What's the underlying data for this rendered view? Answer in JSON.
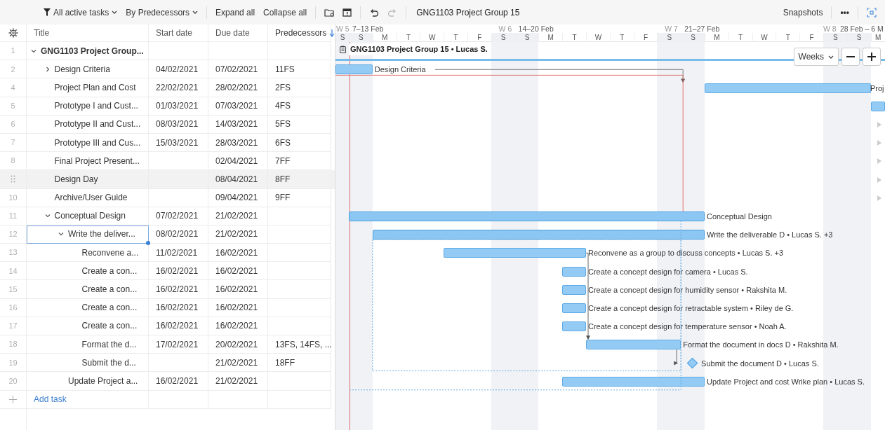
{
  "toolbar": {
    "filter": "All active tasks",
    "grouping": "By Predecessors",
    "actions": [
      "Expand all",
      "Collapse all"
    ],
    "history": [
      {
        "kind": "undo",
        "disabled": false
      },
      {
        "kind": "redo",
        "disabled": true
      }
    ],
    "project_title": "GNG1103 Project Group 15",
    "snapshots": "Snapshots",
    "more": "•••"
  },
  "table": {
    "columns": [
      {
        "label": "Title",
        "sorted": false
      },
      {
        "label": "Start date",
        "sorted": false
      },
      {
        "label": "Due date",
        "sorted": false
      },
      {
        "label": "Predecessors",
        "sorted": true
      }
    ],
    "rows": [
      {
        "number": "1",
        "title": "GNG1103 Project Group...",
        "kind": "project",
        "expanded": true,
        "selected": false,
        "hovered": false,
        "bar_label": "GNG1103 Project Group 15 • Lucas S.",
        "children": [
          {
            "number": "2",
            "title": "Design Criteria",
            "start": "04/02/2021",
            "due": "07/02/2021",
            "predecessors": "11FS",
            "kind": "task",
            "expanded": false,
            "selected": false,
            "hovered": false,
            "bar_label": "Design Criteria"
          },
          {
            "number": "4",
            "title": "Project Plan and Cost",
            "start": "22/02/2021",
            "due": "28/02/2021",
            "predecessors": "2FS",
            "kind": "task",
            "selected": false,
            "hovered": false,
            "bar_label": "Proj"
          },
          {
            "number": "5",
            "title": "Prototype I and Cust...",
            "start": "01/03/2021",
            "due": "07/03/2021",
            "predecessors": "4FS",
            "kind": "task",
            "selected": false,
            "hovered": false
          },
          {
            "number": "6",
            "title": "Prototype II and Cust...",
            "start": "08/03/2021",
            "due": "14/03/2021",
            "predecessors": "5FS",
            "kind": "task",
            "selected": false,
            "hovered": false
          },
          {
            "number": "7",
            "title": "Prototype III and Cus...",
            "start": "15/03/2021",
            "due": "28/03/2021",
            "predecessors": "6FS",
            "kind": "task",
            "selected": false,
            "hovered": false
          },
          {
            "number": "8",
            "title": "Final Project Present...",
            "due": "02/04/2021",
            "predecessors": "7FF",
            "kind": "milestone",
            "selected": false,
            "hovered": false
          },
          {
            "title": "Design Day",
            "due": "08/04/2021",
            "predecessors": "8FF",
            "kind": "milestone",
            "selected": false,
            "hovered": true
          },
          {
            "number": "10",
            "title": "Archive/User Guide",
            "due": "09/04/2021",
            "predecessors": "9FF",
            "kind": "milestone",
            "selected": false,
            "hovered": false
          },
          {
            "number": "11",
            "title": "Conceptual Design",
            "start": "07/02/2021",
            "due": "21/02/2021",
            "kind": "summary",
            "expanded": true,
            "selected": false,
            "hovered": false,
            "bar_label": "Conceptual Design",
            "children": [
              {
                "number": "12",
                "title": "Write the deliver...",
                "start": "08/02/2021",
                "due": "21/02/2021",
                "kind": "summary",
                "expanded": true,
                "selected": true,
                "hovered": false,
                "bar_label": "Write the deliverable D • Lucas S. +3",
                "children": [
                  {
                    "number": "13",
                    "title": "Reconvene a...",
                    "start": "11/02/2021",
                    "due": "16/02/2021",
                    "kind": "task",
                    "selected": false,
                    "hovered": false,
                    "bar_label": "Reconvene as a group to discuss concepts • Lucas S. +3"
                  },
                  {
                    "number": "14",
                    "title": "Create a con...",
                    "start": "16/02/2021",
                    "due": "16/02/2021",
                    "kind": "task",
                    "selected": false,
                    "hovered": false,
                    "bar_label": "Create a concept design for camera • Lucas S."
                  },
                  {
                    "number": "15",
                    "title": "Create a con...",
                    "start": "16/02/2021",
                    "due": "16/02/2021",
                    "kind": "task",
                    "selected": false,
                    "hovered": false,
                    "bar_label": "Create a concept design for humidity sensor • Rakshita M."
                  },
                  {
                    "number": "16",
                    "title": "Create a con...",
                    "start": "16/02/2021",
                    "due": "16/02/2021",
                    "kind": "task",
                    "selected": false,
                    "hovered": false,
                    "bar_label": "Create a concept design for retractable system • Riley de G."
                  },
                  {
                    "number": "17",
                    "title": "Create a con...",
                    "start": "16/02/2021",
                    "due": "16/02/2021",
                    "kind": "task",
                    "selected": false,
                    "hovered": false,
                    "bar_label": "Create a concept design for temperature sensor • Noah A."
                  },
                  {
                    "number": "18",
                    "title": "Format the d...",
                    "start": "17/02/2021",
                    "due": "20/02/2021",
                    "predecessors": "13FS, 14FS, ...",
                    "kind": "task",
                    "selected": false,
                    "hovered": false,
                    "bar_label": "Format the document in docs D • Rakshita M."
                  },
                  {
                    "number": "19",
                    "title": "Submit the d...",
                    "due": "21/02/2021",
                    "predecessors": "18FF",
                    "kind": "milestone",
                    "selected": false,
                    "hovered": false,
                    "bar_label": "Submit the document D • Lucas S."
                  }
                ]
              },
              {
                "number": "20",
                "title": "Update Project a...",
                "start": "16/02/2021",
                "due": "21/02/2021",
                "kind": "task",
                "selected": false,
                "hovered": false,
                "bar_label": "Update Project and cost Wrike plan • Lucas S."
              }
            ]
          }
        ]
      }
    ],
    "add_task": "Add task"
  },
  "gantt": {
    "weeks": [
      {
        "number": "W 5",
        "range": "7–13 Feb"
      },
      {
        "number": "W 6",
        "range": "14–20 Feb"
      },
      {
        "number": "W 7",
        "range": "21–27 Feb"
      },
      {
        "number": "W 8",
        "range": "28 Feb – 6 M"
      }
    ],
    "days": [
      {
        "letter": "S",
        "weekend": true
      },
      {
        "letter": "S",
        "weekend": true
      },
      {
        "letter": "M",
        "weekend": false
      },
      {
        "letter": "T",
        "weekend": false
      },
      {
        "letter": "W",
        "weekend": false
      },
      {
        "letter": "T",
        "weekend": false
      },
      {
        "letter": "F",
        "weekend": false
      },
      {
        "letter": "S",
        "weekend": true
      },
      {
        "letter": "S",
        "weekend": true
      },
      {
        "letter": "M",
        "weekend": false
      },
      {
        "letter": "T",
        "weekend": false
      },
      {
        "letter": "W",
        "weekend": false
      },
      {
        "letter": "T",
        "weekend": false
      },
      {
        "letter": "F",
        "weekend": false
      },
      {
        "letter": "S",
        "weekend": true
      },
      {
        "letter": "S",
        "weekend": true
      },
      {
        "letter": "M",
        "weekend": false
      },
      {
        "letter": "T",
        "weekend": false
      },
      {
        "letter": "W",
        "weekend": false
      },
      {
        "letter": "T",
        "weekend": false
      },
      {
        "letter": "F",
        "weekend": false
      },
      {
        "letter": "S",
        "weekend": true
      },
      {
        "letter": "S",
        "weekend": true
      },
      {
        "letter": "M",
        "weekend": false
      }
    ],
    "scale": "Weeks"
  }
}
